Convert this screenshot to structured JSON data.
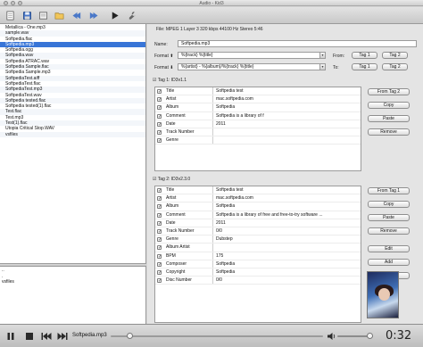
{
  "window": {
    "title": "Audio - Kid3"
  },
  "toolbar": {
    "buttons": [
      "open-icon",
      "save-icon",
      "revert-icon",
      "folder-icon",
      "previous-icon",
      "next-icon",
      "play-icon",
      "settings-icon"
    ]
  },
  "files": [
    "Metallica - One.mp3",
    "sample.wav",
    "Softpedia.flac",
    "Softpedia.mp3",
    "Softpedia.ogg",
    "Softpedia.wav",
    "Softpedia ATRAC.wav",
    "Softpedia Sample.flac",
    "Softpedia Sample.mp3",
    "SoftpediaTest.aiff",
    "SoftpediaTest.flac",
    "SoftpediaTest.mp3",
    "SoftpediaTest.wav",
    "Softpedia tested.flac",
    "Softpedia tested(1).flac",
    "Test.flac",
    "Test.mp3",
    "Test(1).flac",
    "Utopia Critical Stop.WAV",
    "vsfiles"
  ],
  "selected_file": "Softpedia.mp3",
  "folders": [
    "..",
    ".",
    "vsfiles"
  ],
  "file_info": "File: MPEG 1 Layer 3 320 kbps 44100 Hz Stereo 5:46",
  "name_field": {
    "label": "Name:",
    "value": "Softpedia.mp3"
  },
  "format_tag_to_file": {
    "label": "Format ⬆",
    "value": "%{track} %{title}",
    "from_label": "From:",
    "btn1": "Tag 1",
    "btn2": "Tag 2"
  },
  "format_file_to_tag": {
    "label": "Format ⬇",
    "value": "%{artist} - %{album}/%{track} %{title}",
    "to_label": "To:",
    "btn1": "Tag 1",
    "btn2": "Tag 2"
  },
  "tag1": {
    "heading": "Tag 1: ID3v1.1",
    "rows": [
      {
        "field": "Title",
        "value": "Softpedia test",
        "checked": true
      },
      {
        "field": "Artist",
        "value": "mac.softpedia.com",
        "checked": true
      },
      {
        "field": "Album",
        "value": "Softpedia",
        "checked": true
      },
      {
        "field": "Comment",
        "value": "Softpedia is a library of f",
        "checked": true
      },
      {
        "field": "Date",
        "value": "2011",
        "checked": true
      },
      {
        "field": "Track Number",
        "value": "",
        "checked": true
      },
      {
        "field": "Genre",
        "value": "",
        "checked": true
      }
    ],
    "buttons": [
      "From Tag 2",
      "Copy",
      "Paste",
      "Remove"
    ]
  },
  "tag2": {
    "heading": "Tag 2: ID3v2.3.0",
    "rows": [
      {
        "field": "Title",
        "value": "Softpedia test",
        "checked": true
      },
      {
        "field": "Artist",
        "value": "mac.softpedia.com",
        "checked": true
      },
      {
        "field": "Album",
        "value": "Softpedia",
        "checked": true
      },
      {
        "field": "Comment",
        "value": "Softpedia is a library of free and free-to-try software ...",
        "checked": true
      },
      {
        "field": "Date",
        "value": "2011",
        "checked": true
      },
      {
        "field": "Track Number",
        "value": "0/0",
        "checked": true
      },
      {
        "field": "Genre",
        "value": "Dubstep",
        "checked": true
      },
      {
        "field": "Album Artist",
        "value": "",
        "checked": true
      },
      {
        "field": "BPM",
        "value": "175",
        "checked": true
      },
      {
        "field": "Composer",
        "value": "Softpedia",
        "checked": true
      },
      {
        "field": "Copyright",
        "value": "Softpedia",
        "checked": true
      },
      {
        "field": "Disc Number",
        "value": "0/0",
        "checked": true
      }
    ],
    "buttons": [
      "From Tag 1",
      "Copy",
      "Paste",
      "Remove",
      "Edit",
      "Add",
      "Delete"
    ]
  },
  "player": {
    "track": "Softpedia.mp3",
    "time": "0:32",
    "progress": 0.09,
    "volume": 0.9
  }
}
